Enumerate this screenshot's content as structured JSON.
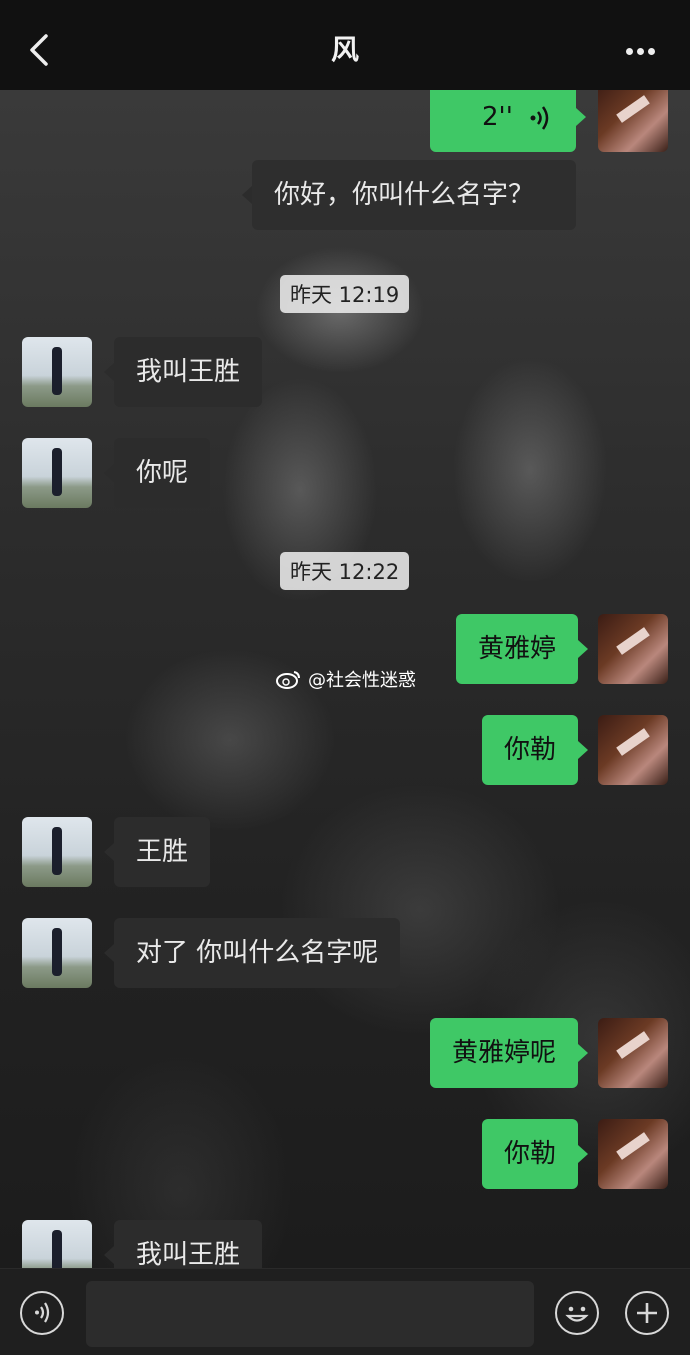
{
  "header": {
    "title": "风"
  },
  "messages": [
    {
      "side": "out",
      "text": "2''",
      "kind": "voice"
    },
    {
      "side": "out",
      "text": "你好，你叫什么名字？"
    },
    {
      "kind": "time",
      "text": "昨天 12:19"
    },
    {
      "side": "in",
      "text": "我叫王胜"
    },
    {
      "side": "in",
      "text": "你呢"
    },
    {
      "kind": "time",
      "text": "昨天 12:22"
    },
    {
      "side": "out",
      "text": "黄雅婷"
    },
    {
      "side": "out",
      "text": "你勒"
    },
    {
      "side": "in",
      "text": "王胜"
    },
    {
      "side": "in",
      "text": "对了 你叫什么名字呢"
    },
    {
      "side": "out",
      "text": "黄雅婷呢"
    },
    {
      "side": "out",
      "text": "你勒"
    },
    {
      "side": "in",
      "text": "我叫王胜"
    }
  ],
  "watermark": {
    "text": "@社会性迷惑"
  },
  "colors": {
    "outgoing": "#3fc866",
    "incoming": "#2c2c2c",
    "topbar": "#111111"
  },
  "icons": {
    "back": "chevron-left-icon",
    "more": "more-dots-icon",
    "voice": "voice-icon",
    "emoji": "emoji-icon",
    "plus": "plus-icon"
  }
}
